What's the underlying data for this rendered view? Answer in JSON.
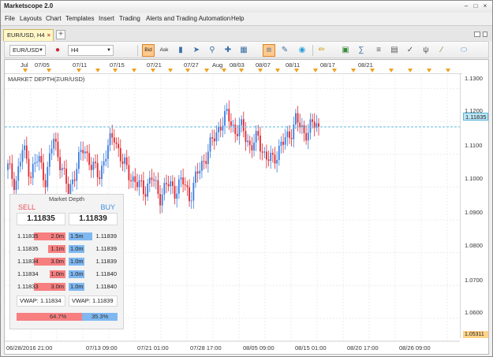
{
  "window": {
    "title": "Marketscope 2.0"
  },
  "menu": [
    "File",
    "Layouts",
    "Chart",
    "Templates",
    "Insert",
    "Trading",
    "Alerts and Trading Automation",
    "Help"
  ],
  "tab": {
    "label": "EUR/USD, H4",
    "add": "+"
  },
  "toolbar": {
    "symbol": "EUR/USD",
    "timeframe": "H4",
    "bid": "Bid",
    "ask": "Ask"
  },
  "date_axis": [
    "Jul",
    "07/05",
    "07/11",
    "07/15",
    "07/21",
    "07/27",
    "Aug",
    "08/03",
    "08/07",
    "08/11",
    "08/17",
    "08/21"
  ],
  "chart_title": "MARKET DEPTH(EUR/USD)",
  "price_axis": [
    "1.1300",
    "1.1200",
    "1.1100",
    "1.1000",
    "1.0900",
    "1.0800",
    "1.0700",
    "1.0600"
  ],
  "current_price": "1.11835",
  "low_price": "1.05311",
  "time_axis": [
    "06/28/2016 21:00",
    "07/13 09:00",
    "07/21 01:00",
    "07/28 17:00",
    "08/05 09:00",
    "08/15 01:00",
    "08/20 17:00",
    "08/26 09:00"
  ],
  "market_depth": {
    "header": "Market Depth",
    "sell_label": "SELL",
    "buy_label": "BUY",
    "sell_price": "1.11835",
    "buy_price": "1.11839",
    "rows": [
      {
        "sell_price": "1.11835",
        "sell_vol": "2.0m",
        "sell_frac": 1.0,
        "buy_vol": "1.5m",
        "buy_frac": 0.75,
        "buy_price": "1.11839"
      },
      {
        "sell_price": "1.11835",
        "sell_vol": "1.1m",
        "sell_frac": 0.55,
        "buy_vol": "1.0m",
        "buy_frac": 0.5,
        "buy_price": "1.11839"
      },
      {
        "sell_price": "1.11834",
        "sell_vol": "3.0m",
        "sell_frac": 1.0,
        "buy_vol": "1.0m",
        "buy_frac": 0.5,
        "buy_price": "1.11839"
      },
      {
        "sell_price": "1.11834",
        "sell_vol": "1.0m",
        "sell_frac": 0.5,
        "buy_vol": "1.0m",
        "buy_frac": 0.5,
        "buy_price": "1.11840"
      },
      {
        "sell_price": "1.11833",
        "sell_vol": "3.0m",
        "sell_frac": 1.0,
        "buy_vol": "1.0m",
        "buy_frac": 0.5,
        "buy_price": "1.11840"
      }
    ],
    "vwap_sell": "VWAP: 1.11834",
    "vwap_buy": "VWAP: 1.11839",
    "sell_ratio": "64.7%",
    "buy_ratio": "35.3%",
    "sell_ratio_value": 0.647
  },
  "colors": {
    "up": "#3b7de0",
    "down": "#e2282f",
    "sell": "#f77f80",
    "buy": "#7fb8f0",
    "bid_active": "#ffc98a"
  },
  "chart_data": {
    "type": "candlestick",
    "instrument": "EUR/USD",
    "timeframe": "H4",
    "y_range": [
      1.053,
      1.133
    ],
    "current_price": 1.11835,
    "closes_approx": [
      1.106,
      1.101,
      1.112,
      1.104,
      1.109,
      1.102,
      1.115,
      1.107,
      1.098,
      1.106,
      1.112,
      1.107,
      1.103,
      1.111,
      1.116,
      1.108,
      1.104,
      1.101,
      1.099,
      1.103,
      1.097,
      1.101,
      1.099,
      1.102,
      1.097,
      1.104,
      1.109,
      1.114,
      1.119,
      1.122,
      1.117,
      1.118,
      1.112,
      1.115,
      1.109,
      1.108,
      1.113,
      1.115,
      1.121,
      1.116,
      1.119,
      1.1184
    ]
  }
}
